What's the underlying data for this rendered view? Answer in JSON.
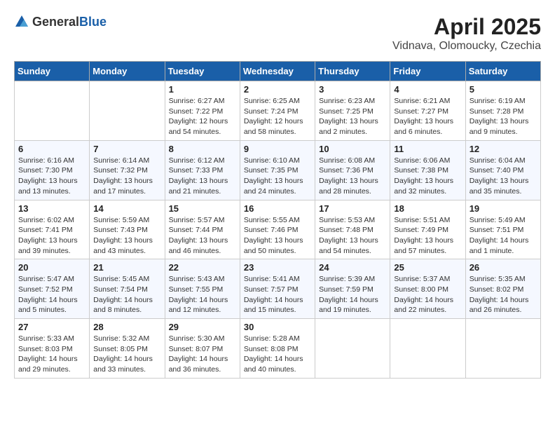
{
  "logo": {
    "general": "General",
    "blue": "Blue"
  },
  "title": "April 2025",
  "location": "Vidnava, Olomoucky, Czechia",
  "weekdays": [
    "Sunday",
    "Monday",
    "Tuesday",
    "Wednesday",
    "Thursday",
    "Friday",
    "Saturday"
  ],
  "weeks": [
    [
      {
        "day": "",
        "info": ""
      },
      {
        "day": "",
        "info": ""
      },
      {
        "day": "1",
        "info": "Sunrise: 6:27 AM\nSunset: 7:22 PM\nDaylight: 12 hours and 54 minutes."
      },
      {
        "day": "2",
        "info": "Sunrise: 6:25 AM\nSunset: 7:24 PM\nDaylight: 12 hours and 58 minutes."
      },
      {
        "day": "3",
        "info": "Sunrise: 6:23 AM\nSunset: 7:25 PM\nDaylight: 13 hours and 2 minutes."
      },
      {
        "day": "4",
        "info": "Sunrise: 6:21 AM\nSunset: 7:27 PM\nDaylight: 13 hours and 6 minutes."
      },
      {
        "day": "5",
        "info": "Sunrise: 6:19 AM\nSunset: 7:28 PM\nDaylight: 13 hours and 9 minutes."
      }
    ],
    [
      {
        "day": "6",
        "info": "Sunrise: 6:16 AM\nSunset: 7:30 PM\nDaylight: 13 hours and 13 minutes."
      },
      {
        "day": "7",
        "info": "Sunrise: 6:14 AM\nSunset: 7:32 PM\nDaylight: 13 hours and 17 minutes."
      },
      {
        "day": "8",
        "info": "Sunrise: 6:12 AM\nSunset: 7:33 PM\nDaylight: 13 hours and 21 minutes."
      },
      {
        "day": "9",
        "info": "Sunrise: 6:10 AM\nSunset: 7:35 PM\nDaylight: 13 hours and 24 minutes."
      },
      {
        "day": "10",
        "info": "Sunrise: 6:08 AM\nSunset: 7:36 PM\nDaylight: 13 hours and 28 minutes."
      },
      {
        "day": "11",
        "info": "Sunrise: 6:06 AM\nSunset: 7:38 PM\nDaylight: 13 hours and 32 minutes."
      },
      {
        "day": "12",
        "info": "Sunrise: 6:04 AM\nSunset: 7:40 PM\nDaylight: 13 hours and 35 minutes."
      }
    ],
    [
      {
        "day": "13",
        "info": "Sunrise: 6:02 AM\nSunset: 7:41 PM\nDaylight: 13 hours and 39 minutes."
      },
      {
        "day": "14",
        "info": "Sunrise: 5:59 AM\nSunset: 7:43 PM\nDaylight: 13 hours and 43 minutes."
      },
      {
        "day": "15",
        "info": "Sunrise: 5:57 AM\nSunset: 7:44 PM\nDaylight: 13 hours and 46 minutes."
      },
      {
        "day": "16",
        "info": "Sunrise: 5:55 AM\nSunset: 7:46 PM\nDaylight: 13 hours and 50 minutes."
      },
      {
        "day": "17",
        "info": "Sunrise: 5:53 AM\nSunset: 7:48 PM\nDaylight: 13 hours and 54 minutes."
      },
      {
        "day": "18",
        "info": "Sunrise: 5:51 AM\nSunset: 7:49 PM\nDaylight: 13 hours and 57 minutes."
      },
      {
        "day": "19",
        "info": "Sunrise: 5:49 AM\nSunset: 7:51 PM\nDaylight: 14 hours and 1 minute."
      }
    ],
    [
      {
        "day": "20",
        "info": "Sunrise: 5:47 AM\nSunset: 7:52 PM\nDaylight: 14 hours and 5 minutes."
      },
      {
        "day": "21",
        "info": "Sunrise: 5:45 AM\nSunset: 7:54 PM\nDaylight: 14 hours and 8 minutes."
      },
      {
        "day": "22",
        "info": "Sunrise: 5:43 AM\nSunset: 7:55 PM\nDaylight: 14 hours and 12 minutes."
      },
      {
        "day": "23",
        "info": "Sunrise: 5:41 AM\nSunset: 7:57 PM\nDaylight: 14 hours and 15 minutes."
      },
      {
        "day": "24",
        "info": "Sunrise: 5:39 AM\nSunset: 7:59 PM\nDaylight: 14 hours and 19 minutes."
      },
      {
        "day": "25",
        "info": "Sunrise: 5:37 AM\nSunset: 8:00 PM\nDaylight: 14 hours and 22 minutes."
      },
      {
        "day": "26",
        "info": "Sunrise: 5:35 AM\nSunset: 8:02 PM\nDaylight: 14 hours and 26 minutes."
      }
    ],
    [
      {
        "day": "27",
        "info": "Sunrise: 5:33 AM\nSunset: 8:03 PM\nDaylight: 14 hours and 29 minutes."
      },
      {
        "day": "28",
        "info": "Sunrise: 5:32 AM\nSunset: 8:05 PM\nDaylight: 14 hours and 33 minutes."
      },
      {
        "day": "29",
        "info": "Sunrise: 5:30 AM\nSunset: 8:07 PM\nDaylight: 14 hours and 36 minutes."
      },
      {
        "day": "30",
        "info": "Sunrise: 5:28 AM\nSunset: 8:08 PM\nDaylight: 14 hours and 40 minutes."
      },
      {
        "day": "",
        "info": ""
      },
      {
        "day": "",
        "info": ""
      },
      {
        "day": "",
        "info": ""
      }
    ]
  ]
}
